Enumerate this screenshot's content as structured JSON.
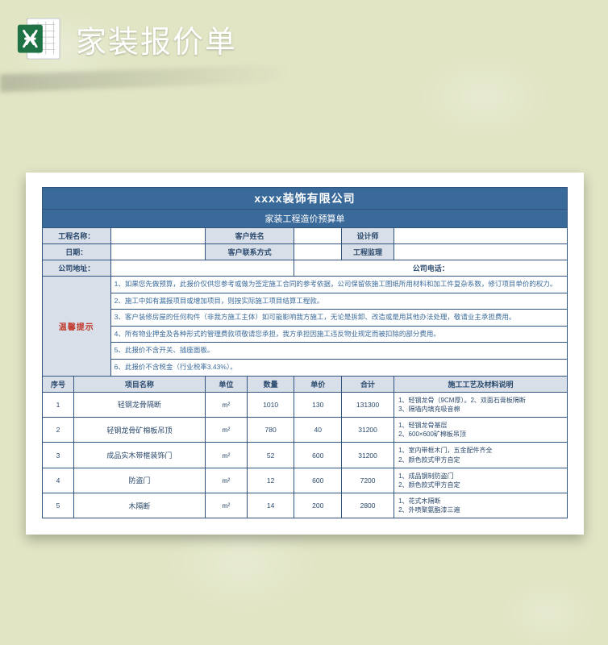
{
  "banner": {
    "title": "家装报价单"
  },
  "doc": {
    "company": "xxxx装饰有限公司",
    "subtitle": "家装工程造价预算单",
    "info_labels": {
      "project": "工程名称：",
      "customer": "客户姓名",
      "designer": "设计师",
      "date": "日期：",
      "contact": "客户联系方式",
      "supervisor": "工程监理",
      "address": "公司地址：",
      "phone": "公司电话："
    },
    "info_values": {
      "project": "",
      "customer": "",
      "designer": "",
      "date": "",
      "contact": "",
      "supervisor": "",
      "address": "",
      "phone": ""
    },
    "tips_label": "温馨提示",
    "tips": [
      "1、如果您先做预算，此报价仅供您参考或做为签定施工合同的参考依据，公司保留依施工图纸所用材料和加工件复杂系数，修订项目单价的权力。",
      "2、施工中如有漏报项目或增加项目，则按实际施工项目结算工程款。",
      "3、客户装修房屋的任何构件（非我方施工主体）如可能影响我方施工，无论是拆卸、改造或是用其他办法处理，敬请业主承担费用。",
      "4、所有物业押金及各种形式的管理费款项敬请您承担，我方承担因施工违反物业规定而被扣除的部分费用。",
      "5、此报价不含开关、插座面板。",
      "6、此报价不含税金（行业税率3.43%）。"
    ],
    "columns": {
      "no": "序号",
      "name": "项目名称",
      "unit": "单位",
      "qty": "数量",
      "price": "单价",
      "total": "合计",
      "desc": "施工工艺及材料说明"
    },
    "unit_m2": "m²",
    "items": [
      {
        "no": "1",
        "name": "轻钢龙骨隔断",
        "qty": "1010",
        "price": "130",
        "total": "131300",
        "desc": "1、轻钢龙骨（9CM厚）。2、双面石膏板隔断\n3、隔墙内填充吸音棉"
      },
      {
        "no": "2",
        "name": "轻钢龙骨矿棉板吊顶",
        "qty": "780",
        "price": "40",
        "total": "31200",
        "desc": "1、轻钢龙骨基层\n2、600×600矿棉板吊顶"
      },
      {
        "no": "3",
        "name": "成品实木带框装饰门",
        "qty": "52",
        "price": "600",
        "total": "31200",
        "desc": "1、室内带框木门，五金配件齐全\n2、颜色款式甲方自定"
      },
      {
        "no": "4",
        "name": "防盗门",
        "qty": "12",
        "price": "600",
        "total": "7200",
        "desc": "1、成品钢制防盗门\n2、颜色款式甲方自定"
      },
      {
        "no": "5",
        "name": "木隔断",
        "qty": "14",
        "price": "200",
        "total": "2800",
        "desc": "1、花式木隔断\n2、外喷聚氨酯漆三遍"
      }
    ]
  }
}
